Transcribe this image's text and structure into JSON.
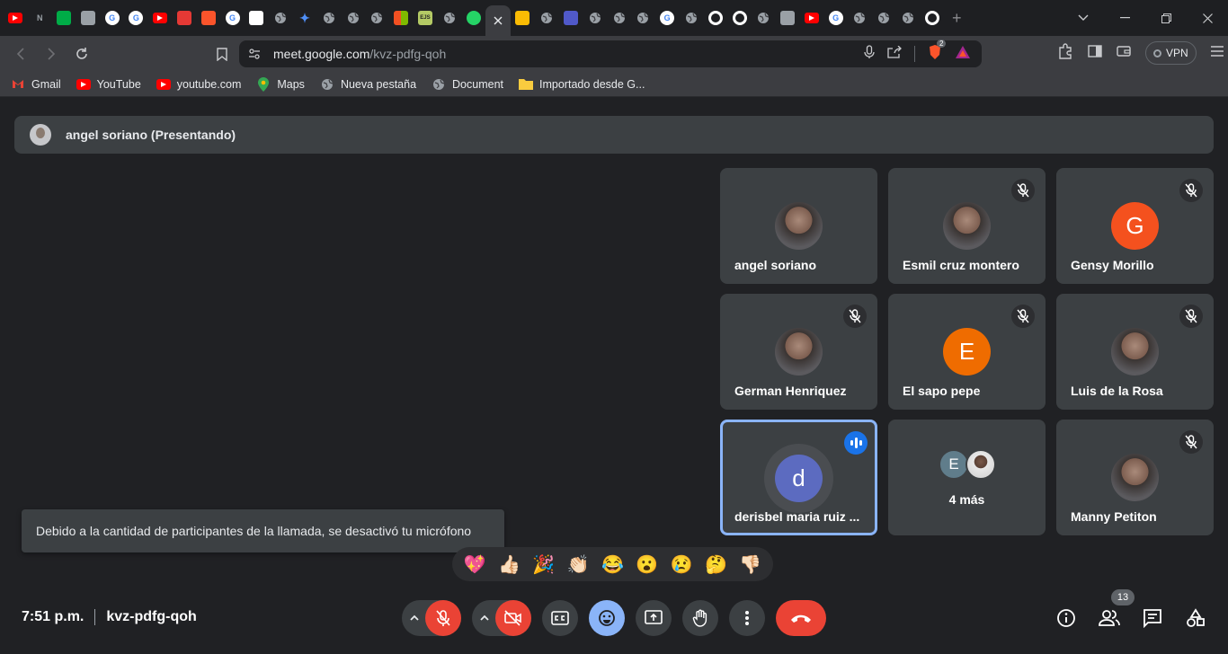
{
  "browser": {
    "tabs": [
      {
        "icon": "youtube-icon",
        "color": "#ff0000"
      },
      {
        "icon": "notion-icon",
        "color": "#3c3d41"
      },
      {
        "icon": "meet-icon",
        "color": "#00ac47"
      },
      {
        "icon": "doc-icon",
        "color": "#9aa0a6"
      },
      {
        "icon": "google-icon",
        "color": "#ffffff"
      },
      {
        "icon": "google-icon",
        "color": "#ffffff"
      },
      {
        "icon": "youtube-icon",
        "color": "#ff0000"
      },
      {
        "icon": "download-icon",
        "color": "#e53935"
      },
      {
        "icon": "brave-icon",
        "color": "#fb542b"
      },
      {
        "icon": "google-icon",
        "color": "#ffffff"
      },
      {
        "icon": "amazon-icon",
        "color": "#ffffff"
      },
      {
        "icon": "globe-icon",
        "color": "#9aa0a6"
      },
      {
        "icon": "gemini-icon",
        "color": "#4f8ff7"
      },
      {
        "icon": "globe-icon",
        "color": "#9aa0a6"
      },
      {
        "icon": "globe-icon",
        "color": "#9aa0a6"
      },
      {
        "icon": "globe-icon",
        "color": "#9aa0a6"
      },
      {
        "icon": "microsoft-icon",
        "color": "#f25022"
      },
      {
        "icon": "ejs-icon",
        "color": "#b4ca65"
      },
      {
        "icon": "globe-icon",
        "color": "#9aa0a6"
      },
      {
        "icon": "whatsapp-icon",
        "color": "#25d366"
      },
      {
        "icon": "close-icon",
        "color": "#e8eaed",
        "active": true
      },
      {
        "icon": "drive-icon",
        "color": "#fbbc04"
      },
      {
        "icon": "globe-icon",
        "color": "#9aa0a6"
      },
      {
        "icon": "teams-icon",
        "color": "#5059c9"
      },
      {
        "icon": "globe-icon",
        "color": "#9aa0a6"
      },
      {
        "icon": "globe-icon",
        "color": "#9aa0a6"
      },
      {
        "icon": "globe-icon",
        "color": "#9aa0a6"
      },
      {
        "icon": "google-icon",
        "color": "#ffffff"
      },
      {
        "icon": "globe-icon",
        "color": "#9aa0a6"
      },
      {
        "icon": "github-icon",
        "color": "#ffffff"
      },
      {
        "icon": "github-icon",
        "color": "#ffffff"
      },
      {
        "icon": "globe-icon",
        "color": "#9aa0a6"
      },
      {
        "icon": "doc-icon",
        "color": "#9aa0a6"
      },
      {
        "icon": "youtube-icon",
        "color": "#ff0000"
      },
      {
        "icon": "google-icon",
        "color": "#ffffff"
      },
      {
        "icon": "globe-icon",
        "color": "#9aa0a6"
      },
      {
        "icon": "globe-icon",
        "color": "#9aa0a6"
      },
      {
        "icon": "globe-icon",
        "color": "#9aa0a6"
      },
      {
        "icon": "github-icon",
        "color": "#ffffff"
      }
    ],
    "url_host": "meet.google.com",
    "url_path": "/kvz-pdfg-qoh",
    "brave_badge": "2",
    "vpn_label": "VPN",
    "bookmarks": [
      {
        "label": "Gmail",
        "icon": "gmail-icon",
        "color": "#ea4335"
      },
      {
        "label": "YouTube",
        "icon": "youtube-icon",
        "color": "#ff0000"
      },
      {
        "label": "youtube.com",
        "icon": "youtube-icon",
        "color": "#ff0000"
      },
      {
        "label": "Maps",
        "icon": "maps-icon",
        "color": "#34a853"
      },
      {
        "label": "Nueva pestaña",
        "icon": "globe-icon",
        "color": "#9aa0a6"
      },
      {
        "label": "Document",
        "icon": "globe-icon",
        "color": "#9aa0a6"
      },
      {
        "label": "Importado desde G...",
        "icon": "folder-icon",
        "color": "#f9cc3f"
      }
    ]
  },
  "meet": {
    "presenter_label": "angel soriano (Presentando)",
    "participants": [
      {
        "name": "angel soriano",
        "avatar": "photo",
        "muted": false
      },
      {
        "name": "Esmil cruz montero",
        "avatar": "photo",
        "muted": true
      },
      {
        "name": "Gensy Morillo",
        "avatar": "letter",
        "letter": "G",
        "color": "#f4511e",
        "muted": true
      },
      {
        "name": "German Henriquez",
        "avatar": "photo",
        "muted": true
      },
      {
        "name": "El sapo pepe",
        "avatar": "letter",
        "letter": "E",
        "color": "#ef6c00",
        "muted": true
      },
      {
        "name": "Luis de la Rosa",
        "avatar": "photo",
        "muted": true
      },
      {
        "name": "derisbel maria ruiz ...",
        "avatar": "letter",
        "letter": "d",
        "color": "#5c6bc0",
        "muted": false,
        "speaking": true
      },
      {
        "name": "4 más",
        "avatar": "group",
        "letter": "E"
      },
      {
        "name": "Manny Petiton",
        "avatar": "photo",
        "muted": true
      }
    ],
    "toast": "Debido a la cantidad de participantes de la llamada, se desactivó tu micrófono",
    "reactions": [
      "💖",
      "👍🏻",
      "🎉",
      "👏🏻",
      "😂",
      "😮",
      "😢",
      "🤔",
      "👎🏻"
    ],
    "time": "7:51 p.m.",
    "meeting_code": "kvz-pdfg-qoh",
    "people_count": "13"
  }
}
